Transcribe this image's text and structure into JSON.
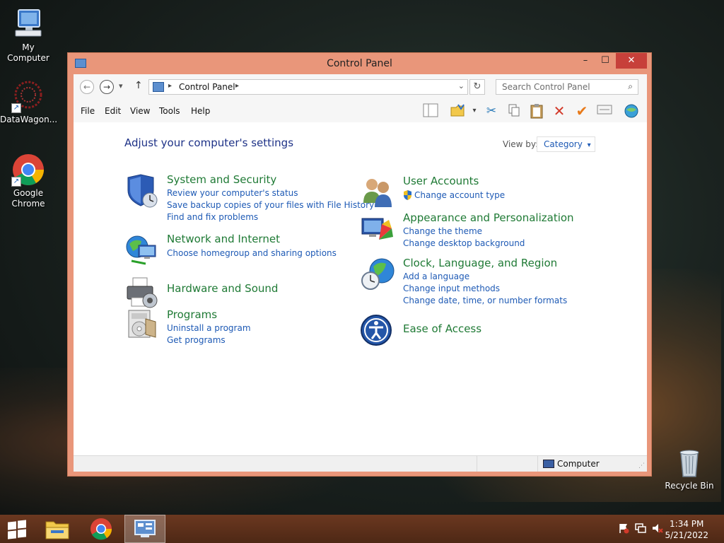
{
  "desktop": {
    "icons": [
      {
        "label": "My Computer"
      },
      {
        "label": "DataWagon..."
      },
      {
        "label": "Google Chrome"
      },
      {
        "label": "Recycle Bin"
      }
    ]
  },
  "window": {
    "title": "Control Panel",
    "controls": {
      "minimize": "–",
      "maximize": "☐",
      "close": "✕"
    }
  },
  "nav": {
    "back": "←",
    "forward": "→",
    "recent": "▾",
    "up": "↑",
    "address_text": "Control Panel",
    "refresh": "↻",
    "search_placeholder": "Search Control Panel",
    "search_icon": "⌕"
  },
  "menu": {
    "items": [
      "File",
      "Edit",
      "View",
      "Tools",
      "Help"
    ]
  },
  "content": {
    "heading": "Adjust your computer's settings",
    "view_by_label": "View by:",
    "view_by_value": "Category",
    "view_by_arrow": "▾",
    "categories_left": [
      {
        "title": "System and Security",
        "links": [
          "Review your computer's status",
          "Save backup copies of your files with File History",
          "Find and fix problems"
        ]
      },
      {
        "title": "Network and Internet",
        "links": [
          "Choose homegroup and sharing options"
        ]
      },
      {
        "title": "Hardware and Sound",
        "links": []
      },
      {
        "title": "Programs",
        "links": [
          "Uninstall a program",
          "Get programs"
        ]
      }
    ],
    "categories_right": [
      {
        "title": "User Accounts",
        "links": [
          "Change account type"
        ]
      },
      {
        "title": "Appearance and Personalization",
        "links": [
          "Change the theme",
          "Change desktop background"
        ]
      },
      {
        "title": "Clock, Language, and Region",
        "links": [
          "Add a language",
          "Change input methods",
          "Change date, time, or number formats"
        ]
      },
      {
        "title": "Ease of Access",
        "links": []
      }
    ]
  },
  "status": {
    "location": "Computer"
  },
  "taskbar": {
    "time": "1:34 PM",
    "date": "5/21/2022"
  },
  "colors": {
    "window_frame": "#e9967a",
    "category_title": "#1f7a35",
    "link": "#1e5ab5",
    "heading": "#1e3287",
    "close_button": "#c7403a"
  }
}
